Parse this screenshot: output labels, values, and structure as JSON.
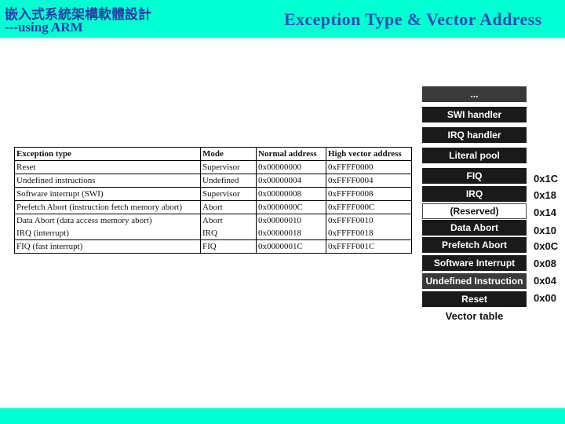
{
  "header": {
    "course_title": "嵌入式系統架構軟體設計",
    "course_subtitle": "---using ARM",
    "slide_title": "Exception Type & Vector Address"
  },
  "colors": {
    "header_band": "#00ffd2",
    "title_text": "#2a50b0",
    "vector_box": "#1a1a1a"
  },
  "exception_table": {
    "columns": [
      "Exception type",
      "Mode",
      "Normal address",
      "High vector address"
    ],
    "rows": [
      [
        "Reset",
        "Supervisor",
        "0x00000000",
        "0xFFFF0000"
      ],
      [
        "Undefined instructions",
        "Undefined",
        "0x00000004",
        "0xFFFF0004"
      ],
      [
        "Software interrupt (SWI)",
        "Supervisor",
        "0x00000008",
        "0xFFFF0008"
      ],
      [
        "Prefetch Abort (instruction fetch memory abort)",
        "Abort",
        "0x0000000C",
        "0xFFFF000C"
      ],
      [
        "Data Abort (data access memory abort)",
        "Abort",
        "0x00000010",
        "0xFFFF0010"
      ],
      [
        "IRQ (interrupt)",
        "IRQ",
        "0x00000018",
        "0xFFFF0018"
      ],
      [
        "FIQ (fast interrupt)",
        "FIQ",
        "0x0000001C",
        "0xFFFF001C"
      ]
    ]
  },
  "vector_table": {
    "caption": "Vector table",
    "entries": [
      {
        "label": "...",
        "address": ""
      },
      {
        "label": "SWI handler",
        "address": ""
      },
      {
        "label": "IRQ handler",
        "address": ""
      },
      {
        "label": "Literal pool",
        "address": ""
      },
      {
        "label": "FIQ",
        "address": "0x1C"
      },
      {
        "label": "IRQ",
        "address": "0x18"
      },
      {
        "label": "(Reserved)",
        "address": "0x14"
      },
      {
        "label": "Data Abort",
        "address": "0x10"
      },
      {
        "label": "Prefetch Abort",
        "address": "0x0C"
      },
      {
        "label": "Software Interrupt",
        "address": "0x08"
      },
      {
        "label": "Undefined Instruction",
        "address": "0x04"
      },
      {
        "label": "Reset",
        "address": "0x00"
      }
    ]
  }
}
